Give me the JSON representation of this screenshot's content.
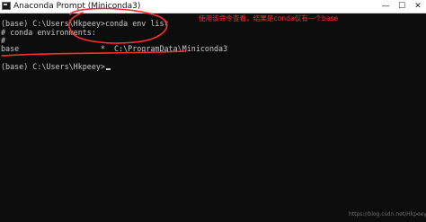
{
  "window": {
    "title": "Anaconda Prompt (Miniconda3)",
    "minimize_glyph": "—",
    "maximize_glyph": "☐",
    "close_glyph": "✕",
    "icon": "terminal-icon"
  },
  "terminal": {
    "lines": [
      "(base) C:\\Users\\Hkpeey>conda env list",
      "# conda environments:",
      "#",
      "base                  *  C:\\ProgramData\\Miniconda3",
      "",
      "(base) C:\\Users\\Hkpeey>"
    ]
  },
  "annotation": {
    "text": "使用该命令查看，结果是conda仅有一个base",
    "color": "#ff2d2d"
  },
  "watermark": "https://blog.csdn.net/Hkpeey",
  "colors": {
    "background": "#0c0c0c",
    "text": "#c9c9c9",
    "titlebar": "#ffffff"
  }
}
